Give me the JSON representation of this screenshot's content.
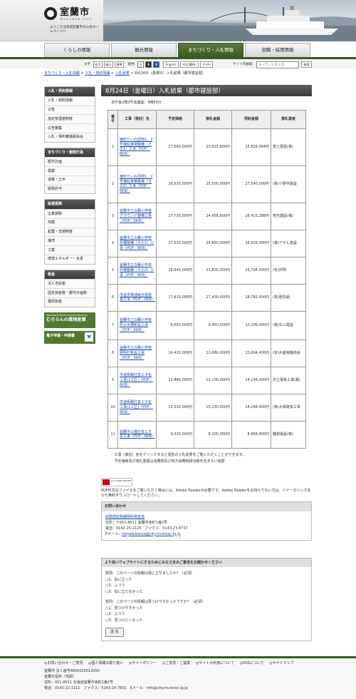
{
  "site": {
    "name": "室蘭市",
    "roman": "MURORAN CITY",
    "tagline": "ようこそ北海道室蘭市の公式ホームページへ"
  },
  "nav": {
    "tabs": [
      {
        "label": "くらしの情報",
        "active": false
      },
      {
        "label": "観光情報",
        "active": false
      },
      {
        "label": "まちづくり・入札情報",
        "active": true
      },
      {
        "label": "就職・採用情報",
        "active": false
      }
    ]
  },
  "toolbar": {
    "text_label": "文字",
    "enlarge": "拡大",
    "shrink": "縮小",
    "standard": "標準",
    "color_label": "配色",
    "color_white": "白",
    "color_black": "黒",
    "color_blue": "青",
    "english": "English",
    "chinese": "中文(簡体)",
    "korean": "한국어",
    "site_search_label": "サイト内検索",
    "search_placeholder": "キーワードを入力",
    "search_button": "検索"
  },
  "breadcrumb": {
    "items": [
      "まちづくり・入札情報",
      "入札・契約情報",
      "入札結果"
    ],
    "sep": " > ",
    "current": "8月24日（金曜日）入札結果（都市建設部）"
  },
  "sidebar": {
    "sections": [
      {
        "title": "入札・契約情報",
        "items": [
          "入札・契約情報",
          "公告",
          "指定管理者制度",
          "広告募集",
          "入札・契約審議委員会"
        ]
      },
      {
        "title": "まちづくり・開発行為",
        "items": [
          "都市計画",
          "建築",
          "道路・土木",
          "開発許可"
        ]
      },
      {
        "title": "産業振興",
        "items": [
          "企業誘致",
          "商業",
          "起業・支援制度",
          "港湾",
          "工業",
          "環境エネルギー・水素"
        ]
      },
      {
        "title": "税金",
        "items": [
          "法人市民税",
          "固定資産税・都市計画税",
          "償却資産"
        ]
      }
    ],
    "banner_env_en": "Muroran Environmental Industries",
    "banner_env_jp": "むろらんの環境産業",
    "banner_e": "電子申請・申請書"
  },
  "main": {
    "title": "8月24日（金曜日）入札結果（都市建設部）",
    "location": "本庁舎2階3号会議室：9時50分",
    "headers": [
      "番号",
      "工事（委託）名",
      "予定価格",
      "落札金額",
      "契約金額",
      "落札業者"
    ],
    "rows": [
      {
        "no": "1",
        "name": "東町たいわ団地1、2号棟駐車場整備（その1）工事（PDF：6KB）",
        "planned": "27,060,000円",
        "bid": "23,915,800円",
        "contract": "25,829,064円",
        "winner": "富士建設(株)"
      },
      {
        "no": "2",
        "name": "東町たいわ団地1、2号棟駐車場整備（その2）工事（PDF：6KB）",
        "planned": "26,320,000円",
        "bid": "25,500,000円",
        "contract": "27,540,000円",
        "winner": "(株)小野寺建設"
      },
      {
        "no": "3",
        "name": "室蘭市立白蘭小学校グラウンド整備工事（PDF：6KB）",
        "planned": "27,730,000円",
        "bid": "24,458,600円",
        "contract": "26,415,288円",
        "winner": "熊光建設(株)"
      },
      {
        "no": "4",
        "name": "室蘭市立白蘭小学校外構整備（その1）工事（PDF：6KB）",
        "planned": "27,010,000円",
        "bid": "24,850,000円",
        "contract": "26,838,000円",
        "winner": "(株)アサヒ建設"
      },
      {
        "no": "5",
        "name": "室蘭市立白蘭小学校外構整備（その2）工事（PDF：6KB）",
        "planned": "26,440,000円",
        "bid": "23,800,000円",
        "contract": "25,704,000円",
        "winner": "(有)共明"
      },
      {
        "no": "6",
        "name": "市道市場通線歩道改良工事（PDF：6KB）",
        "planned": "17,810,000円",
        "bid": "17,400,000円",
        "contract": "18,792,000円",
        "winner": "(株)若佐組"
      },
      {
        "no": "7",
        "name": "室蘭市立白蘭小学校防火水槽新設工事（PDF：6KB）",
        "planned": "9,650,000円",
        "bid": "9,450,000円",
        "contract": "10,206,000円",
        "winner": "(株)丸三建設"
      },
      {
        "no": "8",
        "name": "室蘭市立白蘭小学校照明灯新設工事（PDF：6KB）",
        "planned": "14,410,000円",
        "bid": "12,680,000円",
        "contract": "13,694,400円",
        "winner": "(有)大盛電機商会"
      },
      {
        "no": "9",
        "name": "市道街路灯省エネ化工事(1工区)（PDF：6KB）",
        "planned": "13,440,000円",
        "bid": "13,100,000円",
        "contract": "14,148,000円",
        "winner": "共立電気工事(株)"
      },
      {
        "no": "10",
        "name": "市道街路灯省エネ化工事(2工区)（PDF：6KB）",
        "planned": "13,310,000円",
        "bid": "13,230,000円",
        "contract": "14,288,400円",
        "winner": "(株)大保電気工事"
      },
      {
        "no": "11",
        "name": "室蘭市公園灯省エネ化工事（PDF：6KB）",
        "planned": "9,310,000円",
        "bid": "8,200,000円",
        "contract": "8,856,000円",
        "winner": "鐵和電設(株)"
      }
    ],
    "notes": [
      "工事（委託）名をクリックすると個別の入札結果をご覧いただくことができます。",
      "予定価格及び落札金額は消費税及び地方消費税相当額を含まない金額"
    ],
    "adobe_badge": "Get ADOBE READER",
    "adobe_text": "PDF形式のファイルをご覧いただく場合には、Adobe Readerが必要です。Adobe Readerをお持ちでない方は、バナーのリンク先から無料ダウンロードしてください。",
    "contact": {
      "heading": "お問い合わせ",
      "dept": "総務部総務課契約検査係",
      "address": "住所：〒051-8511 室蘭市幸町1番2号",
      "phone": "電話：0143-25-2125　ファクス：0143-23-8737",
      "email_label": "Eメール：",
      "email": "keiyakukensa@city.muroran.lg.jp"
    },
    "survey": {
      "heading": "より良いウェブサイトにするためにみなさまのご意見をお聞かせください",
      "q1": "質問：このページの情報は役に立ちましたか？（必須）",
      "q1_options": [
        "1：役に立った",
        "2：ふつう",
        "3：役に立たなかった"
      ],
      "q2": "質問：このページの情報は見つけやすかったですか？（必須）",
      "q2_options": [
        "1：見つけやすかった",
        "2：ふつう",
        "3：見つけにくかった"
      ],
      "submit": "送 信"
    }
  },
  "footer": {
    "links": [
      "お問い合わせ・ご意見",
      "個人情報の取り扱い",
      "サイトポリシー",
      "ご意見・ご提案",
      "サイトの利用について",
      "RSSについて",
      "サイトマップ"
    ],
    "corp": "室蘭市 法人番号8000020012050",
    "office": "室蘭市役所（地図）",
    "address": "住所：051-8511 北海道室蘭市幸町1番2号",
    "contact": "電話：0143-22-1111　ファクス：0143-24-7601　Eメール：info@city.muroran.lg.jp"
  }
}
